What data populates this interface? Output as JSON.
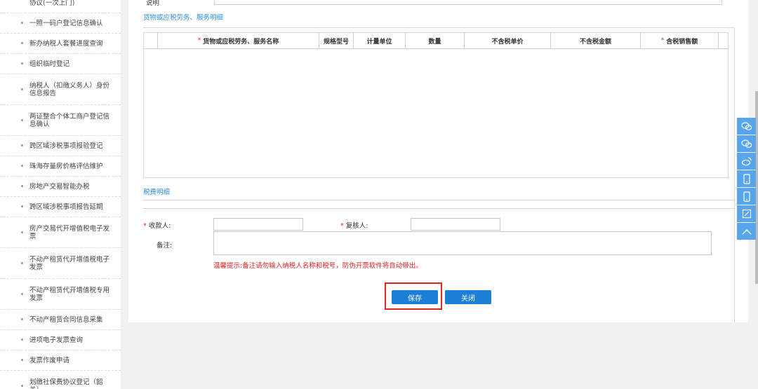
{
  "sidebar": {
    "items": [
      {
        "label": "协议(一次上门)"
      },
      {
        "label": "一照一码户登记信息确认"
      },
      {
        "label": "新办纳税人套餐进度查询"
      },
      {
        "label": "组织临时登记"
      },
      {
        "label": "纳税人（扣缴义务人）身份信息报告"
      },
      {
        "label": "两证整合个体工商户登记信息确认"
      },
      {
        "label": "跨区域涉税事项报验登记"
      },
      {
        "label": "珠海存量房价格评估维护"
      },
      {
        "label": "房地产交易智能办税"
      },
      {
        "label": "跨区域涉税事项报告延期"
      },
      {
        "label": "房产交易代开增值税电子发票"
      },
      {
        "label": "不动产租赁代开增值税电子发票"
      },
      {
        "label": "不动产租赁代开增值税专用发票"
      },
      {
        "label": "不动产租赁合同信息采集"
      },
      {
        "label": "进项电子发票查询"
      },
      {
        "label": "发票作废申请"
      },
      {
        "label": "划缴社保费协议登记（韶关）"
      }
    ]
  },
  "form": {
    "top_label": "说明",
    "goods_section_title": "货物或应税劳务、服务明细",
    "goods_columns": [
      {
        "label": "货物或应税劳务、服务名称",
        "required": "*"
      },
      {
        "label": "规格型号",
        "required": ""
      },
      {
        "label": "计量单位",
        "required": ""
      },
      {
        "label": "数量",
        "required": ""
      },
      {
        "label": "不含税单价",
        "required": ""
      },
      {
        "label": "不含税金额",
        "required": ""
      },
      {
        "label": "含税销售额",
        "required": "*"
      }
    ],
    "tax_section_title": "税费明细",
    "payee_label": "收款人:",
    "payee_value": "",
    "reviewer_label": "复核人:",
    "reviewer_value": "",
    "remark_label": "备注:",
    "remark_value": "",
    "required_mark": "*",
    "tip": "温馨提示:备注请勿输入纳税人名称和税号，防伪开票软件将自动带出。",
    "save_label": "保存",
    "close_label": "关闭"
  },
  "float_bar": {
    "icons": [
      "wechat-icon",
      "wechat-icon",
      "weibo-icon",
      "mobile-icon",
      "mobile-icon",
      "edit-icon",
      "back-to-top-icon"
    ]
  },
  "colors": {
    "accent": "#1b7fd6",
    "section_title": "#2a8ee6",
    "required": "#e02020",
    "highlight": "#e0261b",
    "float_bar": "#58a5ec"
  }
}
